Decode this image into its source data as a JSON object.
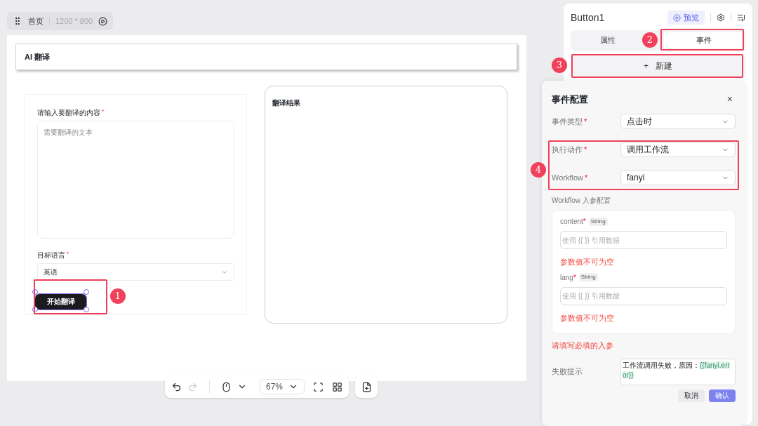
{
  "breadcrumb": {
    "page": "首页",
    "size": "1200 * 800"
  },
  "app": {
    "title": "AI 翻译",
    "content_label": "请输入要翻译的内容",
    "content_mark": "*",
    "content_placeholder": "需要翻译的文本",
    "lang_label": "目标语言",
    "lang_mark": "*",
    "lang_value": "英语",
    "button": "开始翻译",
    "button_selected": true,
    "result_title": "翻译结果"
  },
  "toolbar": {
    "zoom": "67%",
    "redo_disabled": true
  },
  "panel": {
    "title": "Button1",
    "preview": "预览",
    "tabs": [
      {
        "label": "属性",
        "selected": false
      },
      {
        "label": "事件",
        "selected": true
      }
    ],
    "new_icon": "+",
    "new_button": "新建"
  },
  "event_config": {
    "title": "事件配置",
    "close": "×",
    "fields": [
      {
        "label": "事件类型",
        "mark": "*",
        "value": "点击时"
      },
      {
        "label": "执行动作",
        "mark": "*",
        "value": "调用工作流"
      },
      {
        "label": "Workflow",
        "mark": "*",
        "value": "fanyi"
      }
    ],
    "params_title": "Workflow 入参配置",
    "params": [
      {
        "name": "content",
        "mark": "*",
        "type": "String",
        "placeholder": "使用 {{ }} 引用数据",
        "error": "参数值不可为空"
      },
      {
        "name": "lang",
        "mark": "*",
        "type": "String",
        "placeholder": "使用 {{ }} 引用数据",
        "error": "参数值不可为空"
      }
    ],
    "error": "请填写必填的入参",
    "failure_label": "失败提示",
    "failure_text": "工作流调用失败，原因：",
    "failure_var": "{{fanyi.error}}",
    "buttons": [
      {
        "label": "取消",
        "kind": "secondary"
      },
      {
        "label": "确认",
        "kind": "primary"
      }
    ]
  },
  "annotations": [
    {
      "label": "1"
    },
    {
      "label": "2"
    },
    {
      "label": "3"
    },
    {
      "label": "4"
    }
  ]
}
